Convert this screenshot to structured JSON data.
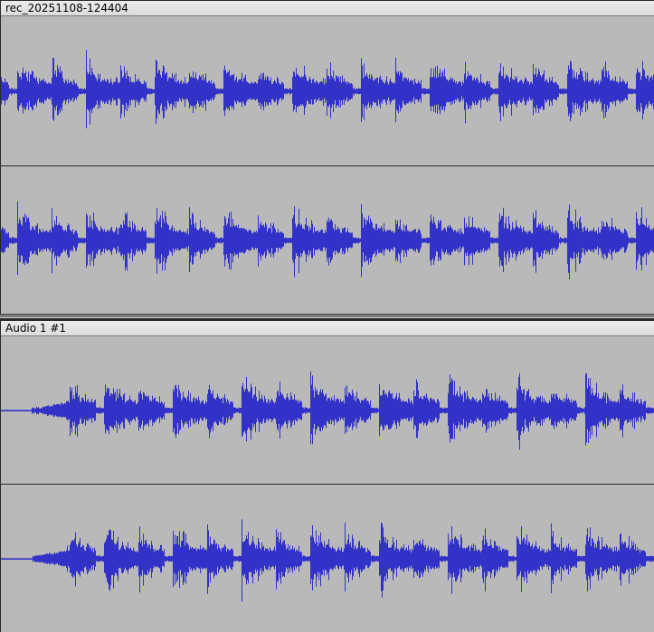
{
  "tracks": [
    {
      "clip_name": "rec_20251108-124404",
      "channels": 2,
      "start_offset": 0.0,
      "waveform_color": "#3232c8"
    },
    {
      "clip_name": "Audio 1 #1",
      "channels": 2,
      "start_offset": 0.1,
      "waveform_color": "#3232c8"
    }
  ],
  "colors": {
    "background": "#b9b9b9",
    "waveform": "#3232c8",
    "waveform_fill": "#5a5ad8",
    "title_bar": "#e4e4e4",
    "border": "#2a2a2a"
  }
}
